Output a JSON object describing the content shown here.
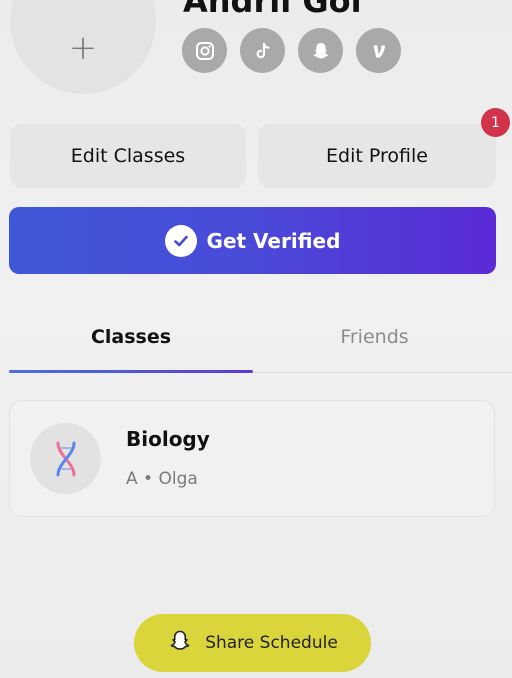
{
  "profile": {
    "avatar_glyph": "+",
    "name": "Andrii Gol",
    "socials": [
      {
        "icon": "instagram-icon"
      },
      {
        "icon": "tiktok-icon"
      },
      {
        "icon": "snapchat-icon"
      },
      {
        "icon": "venmo-icon"
      }
    ]
  },
  "actions": {
    "edit_classes_label": "Edit Classes",
    "edit_profile_label": "Edit Profile",
    "notification_count": "1"
  },
  "verify": {
    "label": "Get Verified",
    "icon": "check-circle-icon"
  },
  "tabs": [
    {
      "label": "Classes",
      "active": true
    },
    {
      "label": "Friends",
      "active": false
    }
  ],
  "classes": [
    {
      "title": "Biology",
      "meta": "A • Olga",
      "icon": "dna-icon"
    }
  ],
  "share": {
    "label": "Share Schedule",
    "icon": "snapchat-ghost-icon"
  },
  "colors": {
    "verify_gradient_start": "#3f58d8",
    "verify_gradient_end": "#5a2ad6",
    "badge": "#d1334a",
    "share_button": "#d9d53a"
  }
}
